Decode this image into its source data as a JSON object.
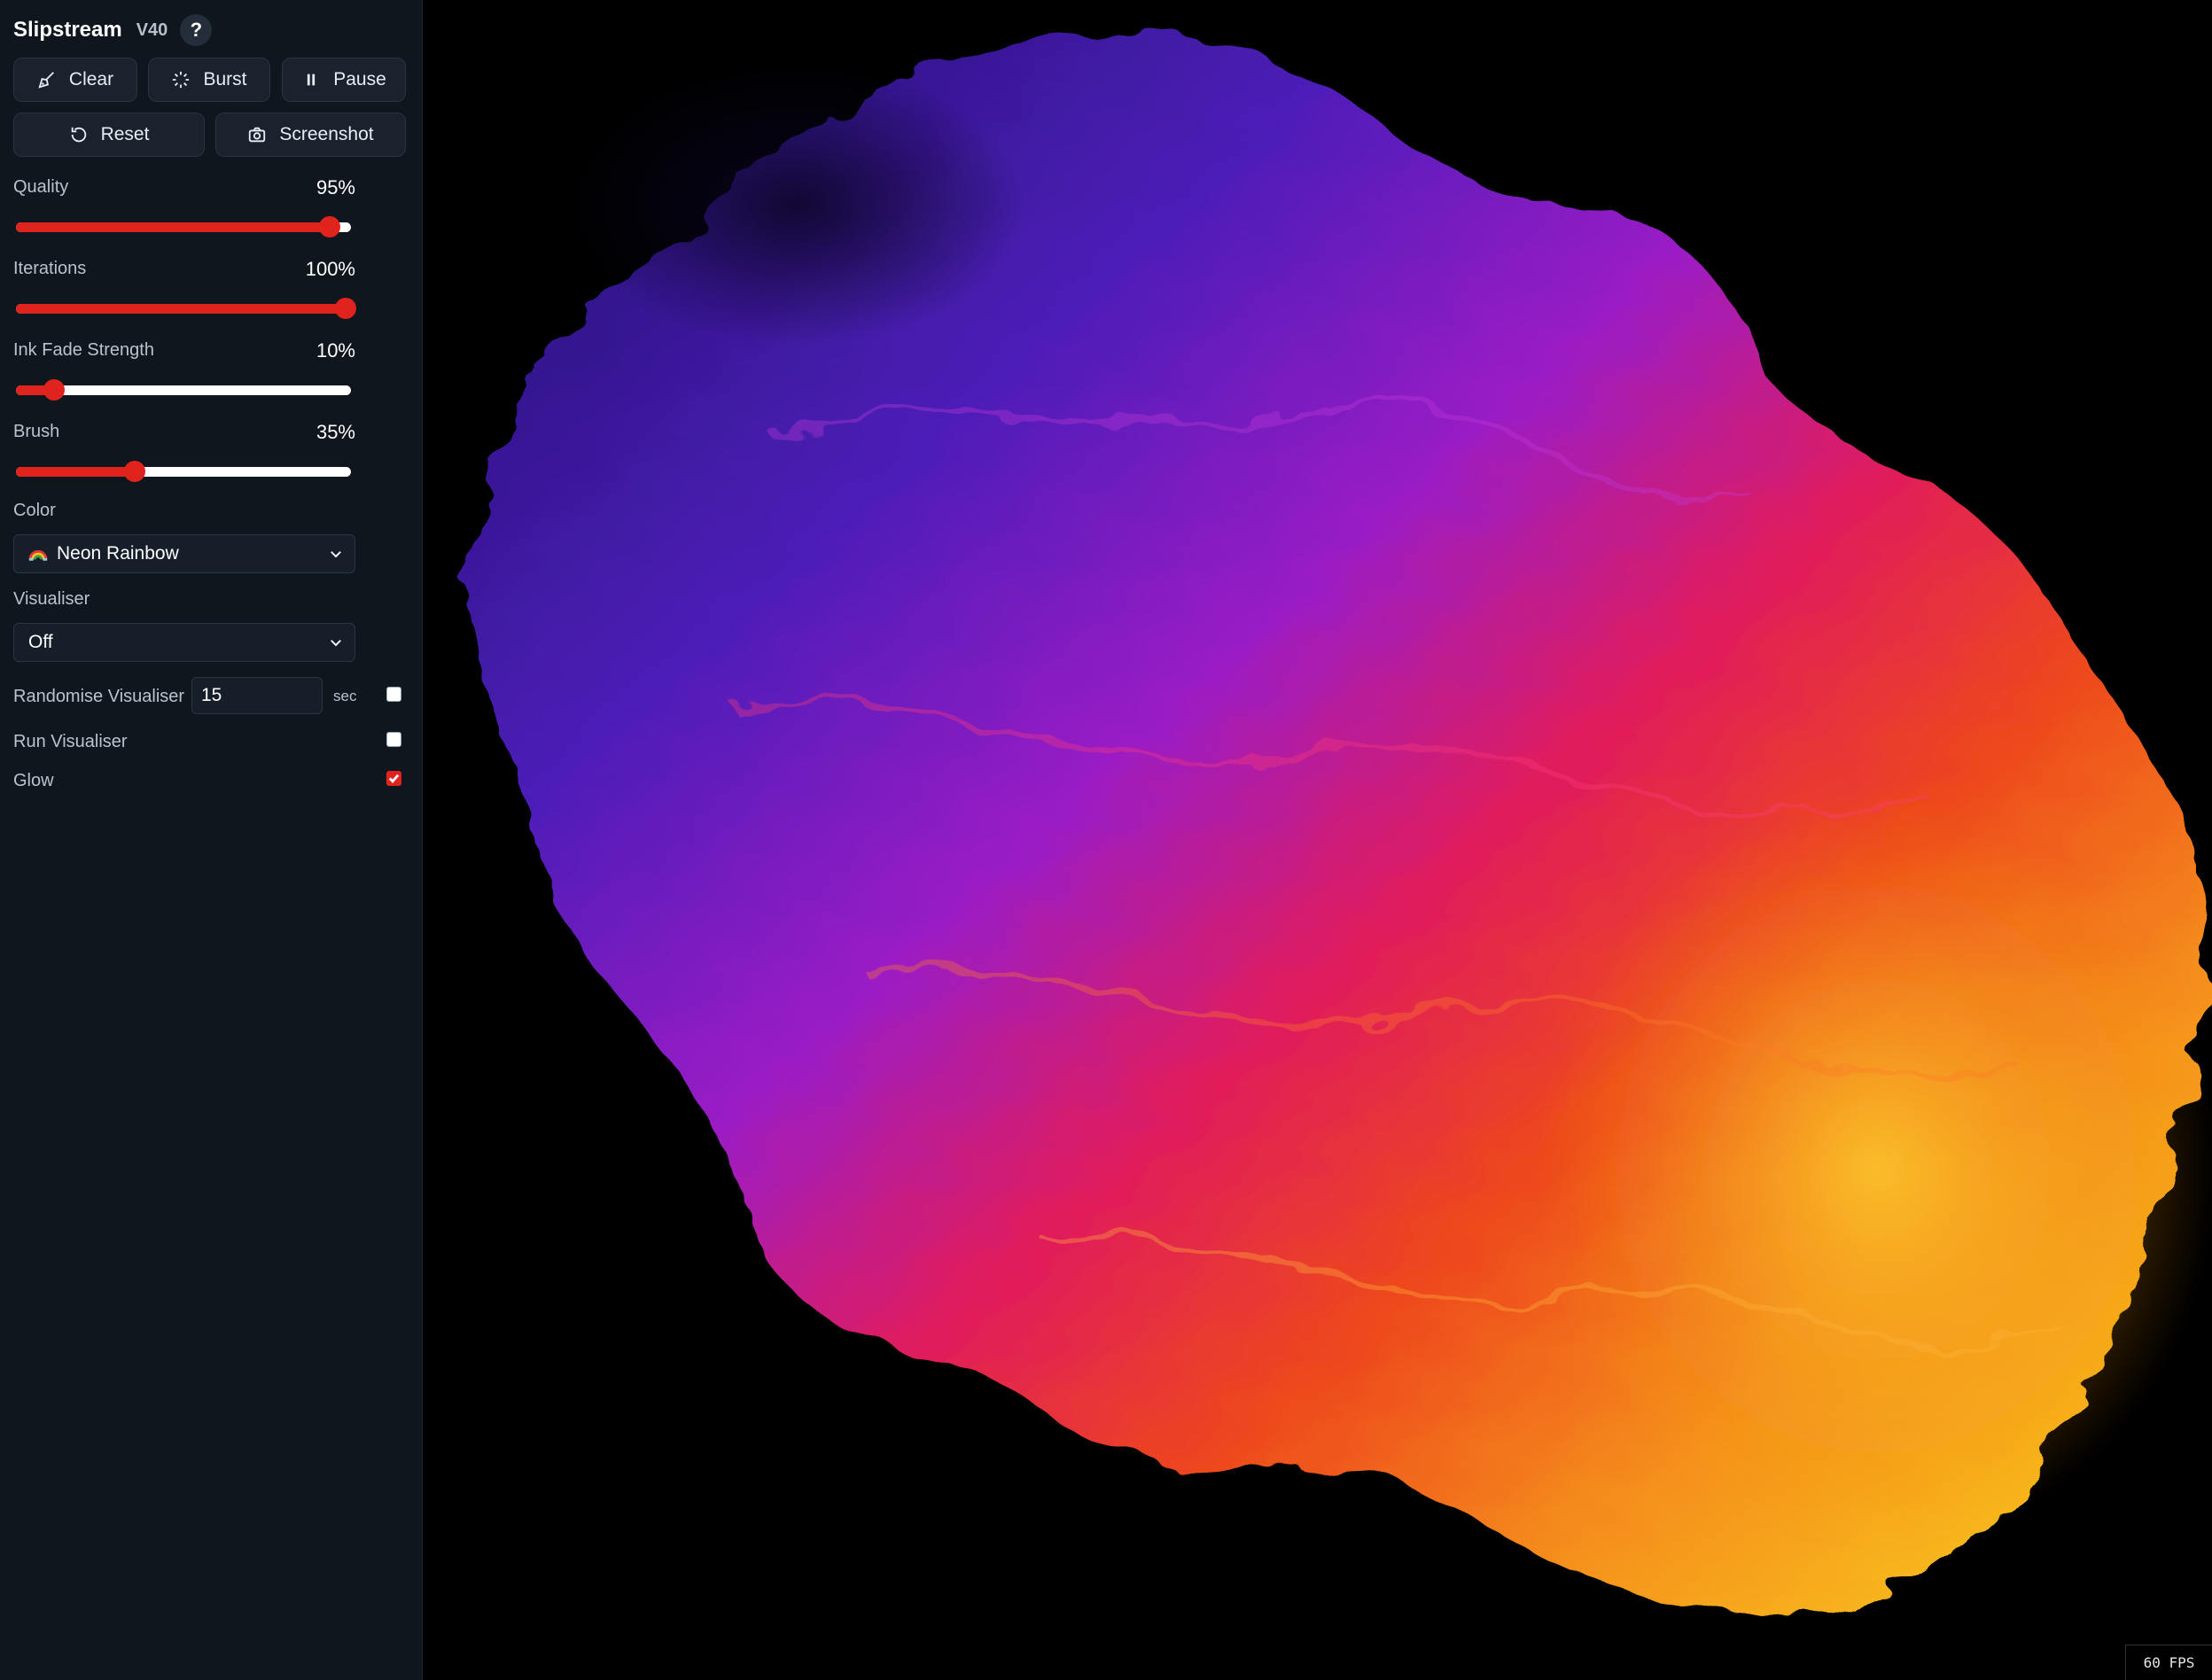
{
  "app": {
    "title": "Slipstream",
    "version": "V40",
    "help_label": "?"
  },
  "buttons": {
    "clear": "Clear",
    "burst": "Burst",
    "pause": "Pause",
    "reset": "Reset",
    "screenshot": "Screenshot"
  },
  "sliders": {
    "quality": {
      "label": "Quality",
      "value_text": "95%",
      "value": 0.95
    },
    "iterations": {
      "label": "Iterations",
      "value_text": "100%",
      "value": 1.0
    },
    "ink_fade": {
      "label": "Ink Fade Strength",
      "value_text": "10%",
      "value": 0.1
    },
    "brush": {
      "label": "Brush",
      "value_text": "35%",
      "value": 0.35
    }
  },
  "color": {
    "label": "Color",
    "selected": "Neon Rainbow"
  },
  "visualiser": {
    "label": "Visualiser",
    "selected": "Off"
  },
  "randomise": {
    "label": "Randomise Visualiser",
    "value": "15",
    "unit": "sec",
    "checked": false
  },
  "run_visualiser": {
    "label": "Run Visualiser",
    "checked": false
  },
  "glow": {
    "label": "Glow",
    "checked": true
  },
  "status": {
    "fps": "60 FPS"
  },
  "colors": {
    "accent": "#e0241d",
    "panel_bg": "#0f161e",
    "canvas_bg": "#000000",
    "ink_gradient": [
      "#3a1aa8",
      "#8a1fc8",
      "#e01a5a",
      "#f06a12",
      "#f7b21a"
    ]
  },
  "icons": {
    "clear": "broom-icon",
    "burst": "burst-icon",
    "pause": "pause-icon",
    "reset": "reset-icon",
    "screenshot": "camera-icon"
  }
}
